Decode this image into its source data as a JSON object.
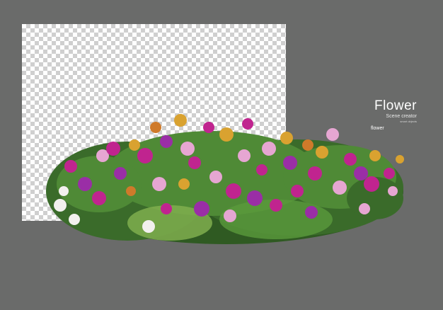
{
  "brand": {
    "title": "Flower",
    "subtitle": "Scene creator",
    "tagline": "smart objects"
  },
  "label": "flower",
  "colors": {
    "background": "#6a6b6a",
    "checker_light": "#ffffff",
    "checker_dark": "#cfcfcf",
    "leaf_dark": "#2f5a22",
    "leaf_mid": "#4f8a36",
    "leaf_light": "#7fae4e",
    "flower_magenta": "#c0248f",
    "flower_purple": "#9a2ea6",
    "flower_pink": "#e6a6d2",
    "flower_white": "#f2f0ee",
    "flower_yellow": "#d9a230",
    "flower_orange": "#cf7a2a"
  }
}
